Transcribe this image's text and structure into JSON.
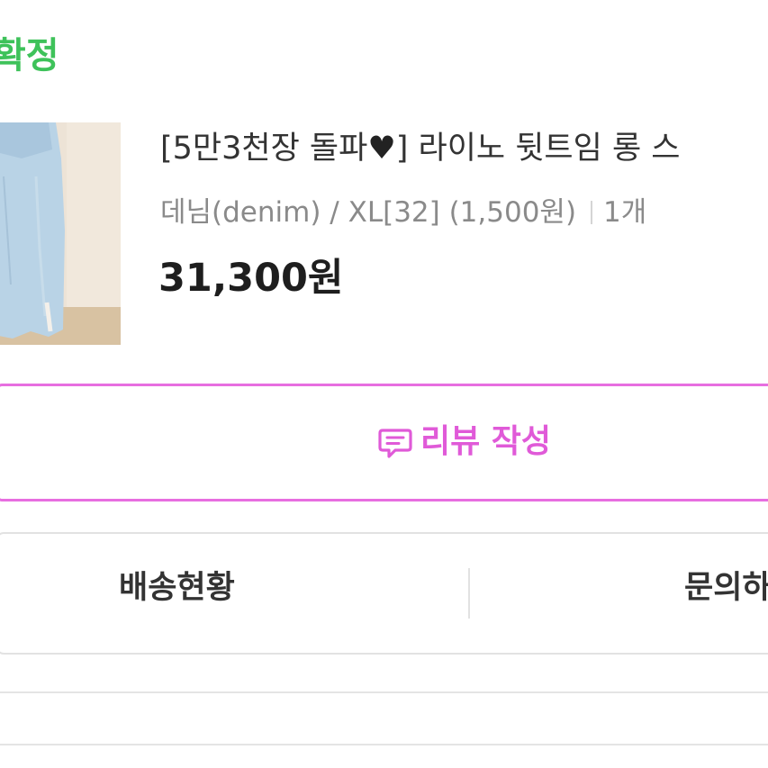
{
  "order": {
    "status": "확정",
    "product": {
      "title_prefix": "[5만3천장 돌파",
      "title_heart": "♥",
      "title_suffix": "] 라이노 뒷트임 롱 스",
      "option": "데님(denim) / XL[32] (1,500원)",
      "quantity": "1개",
      "price": "31,300원"
    }
  },
  "actions": {
    "review_label": "리뷰 작성"
  },
  "tabs": {
    "shipping": "배송현황",
    "inquiry": "문의하"
  },
  "colors": {
    "status_green": "#3ec25a",
    "review_pink": "#e05ad8",
    "border_pink": "#e76ee0"
  }
}
